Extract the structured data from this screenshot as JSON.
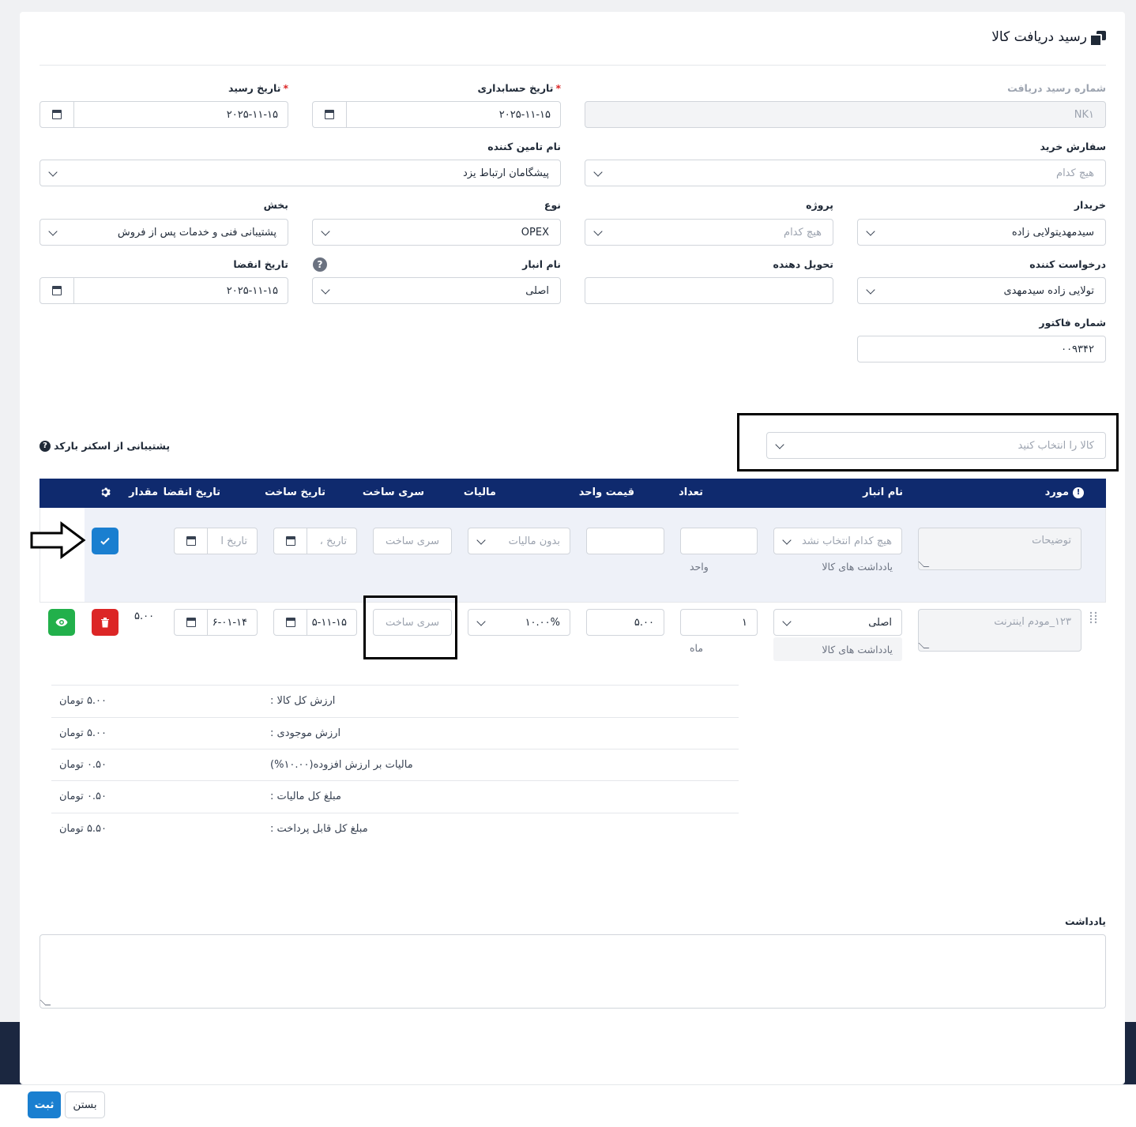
{
  "page": {
    "title": "رسید دریافت کالا"
  },
  "form": {
    "receipt_number": {
      "label": "شماره رسید دریافت",
      "value": "NK۱"
    },
    "accounting_date": {
      "label": "تاریخ حسابداری",
      "required": "*",
      "value": "۲۰۲۵-۱۱-۱۵"
    },
    "receipt_date": {
      "label": "تاریخ رسید",
      "required": "*",
      "value": "۲۰۲۵-۱۱-۱۵"
    },
    "purchase_order": {
      "label": "سفارش خرید",
      "value": "هیچ کدام"
    },
    "supplier": {
      "label": "نام تامین کننده",
      "value": "پیشگامان ارتباط یزد"
    },
    "buyer": {
      "label": "خریدار",
      "value": "سیدمهدیتولایی زاده"
    },
    "project": {
      "label": "پروژه",
      "value": "هیچ کدام"
    },
    "type": {
      "label": "نوع",
      "value": "OPEX"
    },
    "department": {
      "label": "بخش",
      "value": "پشتیبانی فنی و خدمات پس از فروش"
    },
    "requester": {
      "label": "درخواست کننده",
      "value": "تولایی زاده سیدمهدی"
    },
    "deliverer": {
      "label": "تحویل دهنده",
      "value": ""
    },
    "warehouse": {
      "label": "نام انبار",
      "value": "اصلی",
      "help": "?"
    },
    "expiry_date": {
      "label": "تاریخ انقضا",
      "value": "۲۰۲۵-۱۱-۱۵"
    },
    "invoice_number": {
      "label": "شماره فاکتور",
      "value": "۰۰۹۳۴۲"
    }
  },
  "product_select": {
    "placeholder": "کالا را انتخاب کنید"
  },
  "barcode": {
    "label": "پشتیبانی از اسکنر بارکد",
    "help": "?"
  },
  "table": {
    "headers": {
      "item": "مورد",
      "warehouse": "نام انبار",
      "quantity": "تعداد",
      "unit_price": "قیمت واحد",
      "tax": "مالیات",
      "batch": "سری ساخت",
      "production_date": "تاریخ ساخت",
      "expiry_date": "تاریخ انقضا",
      "amount": "مقدار"
    },
    "new_row": {
      "description_placeholder": "توضیحات",
      "warehouse": "هیچ کدام انتخاب نشد",
      "notes": "یادداشت های کالا",
      "unit_label": "واحد",
      "tax": "بدون مالیات",
      "batch_placeholder": "سری ساخت",
      "production_placeholder": "تاریخ ،",
      "expiry_placeholder": "تاریخ ا"
    },
    "rows": [
      {
        "description": "۱۲۳_مودم اینترنت",
        "warehouse": "اصلی",
        "notes": "یادداشت های کالا",
        "quantity": "۱",
        "unit": "ماه",
        "unit_price": "۵.۰۰",
        "tax": "۱۰.۰۰%",
        "batch_placeholder": "سری ساخت",
        "production_date": "۵-۱۱-۱۵",
        "expiry_date": "۶-۰۱-۱۴",
        "amount": "۵.۰۰"
      }
    ]
  },
  "summary": [
    {
      "label": "ارزش کل کالا :",
      "value": "۵.۰۰ تومان"
    },
    {
      "label": "ارزش موجودی :",
      "value": "۵.۰۰ تومان"
    },
    {
      "label": "مالیات بر ارزش افزوده(۱۰.۰۰%)",
      "value": "۰.۵۰ تومان"
    },
    {
      "label": "مبلغ کل مالیات :",
      "value": "۰.۵۰ تومان"
    },
    {
      "label": "مبلغ کل قابل پرداخت :",
      "value": "۵.۵۰ تومان"
    }
  ],
  "note": {
    "label": "یادداشت",
    "value": ""
  },
  "footer": {
    "submit": "ثبت",
    "close": "بستن"
  },
  "colors": {
    "header_bg": "#0f2a6e",
    "primary": "#1a7fd0",
    "danger": "#dc2626",
    "success": "#22b04b"
  }
}
